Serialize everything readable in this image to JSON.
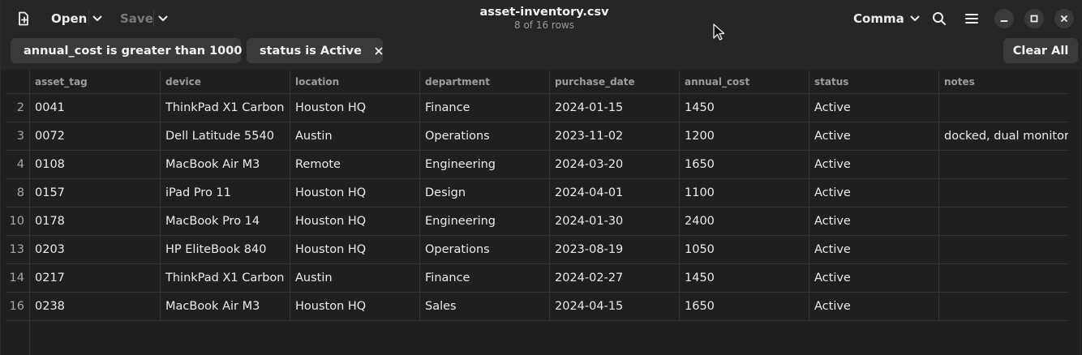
{
  "header": {
    "open_label": "Open",
    "save_label": "Save",
    "title": "asset-inventory.csv",
    "subtitle": "8 of 16 rows",
    "delimiter_label": "Comma"
  },
  "filters": [
    {
      "label": "annual_cost is greater than 1000"
    },
    {
      "label": "status is Active"
    }
  ],
  "clear_all_label": "Clear All",
  "table": {
    "columns": [
      "asset_tag",
      "device",
      "location",
      "department",
      "purchase_date",
      "annual_cost",
      "status",
      "notes"
    ],
    "rows": [
      {
        "num": "2",
        "cells": [
          "0041",
          "ThinkPad X1 Carbon",
          "Houston HQ",
          "Finance",
          "2024-01-15",
          "1450",
          "Active",
          ""
        ]
      },
      {
        "num": "3",
        "cells": [
          "0072",
          "Dell Latitude 5540",
          "Austin",
          "Operations",
          "2023-11-02",
          "1200",
          "Active",
          "docked, dual monitor"
        ]
      },
      {
        "num": "4",
        "cells": [
          "0108",
          "MacBook Air M3",
          "Remote",
          "Engineering",
          "2024-03-20",
          "1650",
          "Active",
          ""
        ]
      },
      {
        "num": "8",
        "cells": [
          "0157",
          "iPad Pro 11",
          "Houston HQ",
          "Design",
          "2024-04-01",
          "1100",
          "Active",
          ""
        ]
      },
      {
        "num": "10",
        "cells": [
          "0178",
          "MacBook Pro 14",
          "Houston HQ",
          "Engineering",
          "2024-01-30",
          "2400",
          "Active",
          ""
        ]
      },
      {
        "num": "13",
        "cells": [
          "0203",
          "HP EliteBook 840",
          "Houston HQ",
          "Operations",
          "2023-08-19",
          "1050",
          "Active",
          ""
        ]
      },
      {
        "num": "14",
        "cells": [
          "0217",
          "ThinkPad X1 Carbon",
          "Austin",
          "Finance",
          "2024-02-27",
          "1450",
          "Active",
          ""
        ]
      },
      {
        "num": "16",
        "cells": [
          "0238",
          "MacBook Air M3",
          "Houston HQ",
          "Sales",
          "2024-04-15",
          "1650",
          "Active",
          ""
        ]
      }
    ]
  },
  "icons": {
    "new_document": "new-document-icon",
    "chevron": "chevron-down-icon",
    "search": "search-icon",
    "menu": "hamburger-menu-icon",
    "minimize": "minimize-icon",
    "maximize": "maximize-icon",
    "close": "close-icon"
  },
  "colors": {
    "background": "#1f1f1f",
    "header": "#262626",
    "chip": "#3a3a3a",
    "text": "#ececec",
    "muted": "#9c9c9c",
    "grid": "#333333"
  }
}
